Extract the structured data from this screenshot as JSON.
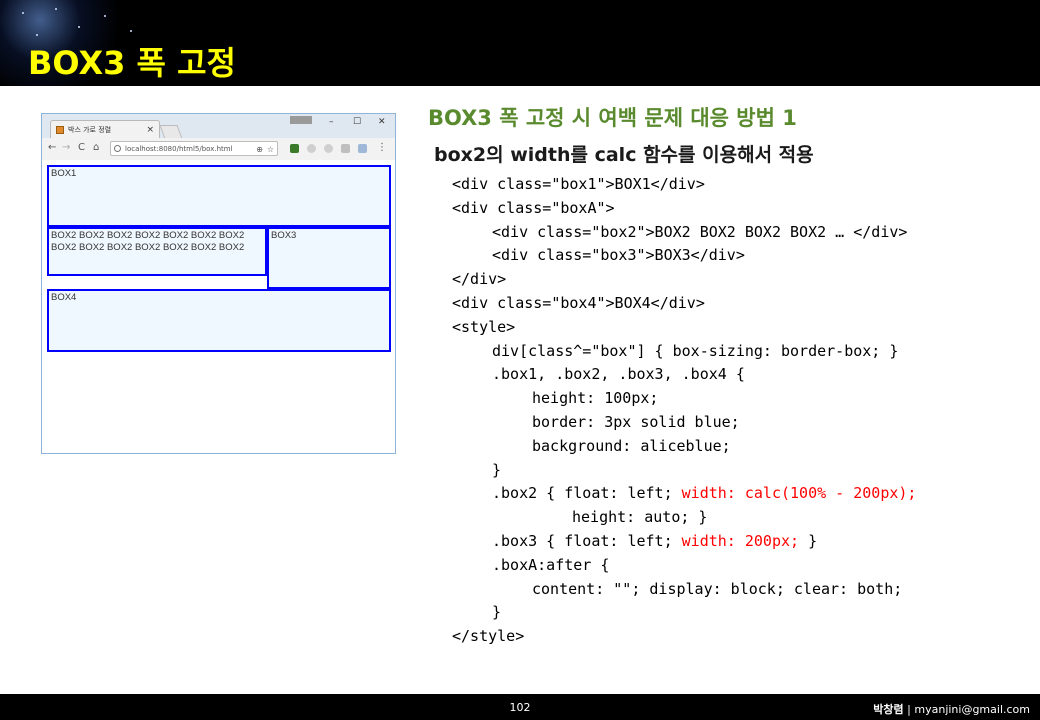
{
  "slide": {
    "title": "BOX3 폭 고정",
    "subtitle": "BOX3 폭 고정 시 여백 문제 대응 방법 1",
    "heading": "box2의 width를 calc 함수를 이용해서 적용",
    "colors": {
      "title": "#ffff00",
      "subtitle": "#5a8a2e",
      "highlight": "#ff0000",
      "demo_border": "#0000ff",
      "demo_background": "#f0f8ff"
    }
  },
  "browser": {
    "tab_label": "박스 가로 정렬",
    "tab_close": "×",
    "window_controls": [
      "–",
      "☐",
      "✕"
    ],
    "nav_buttons": [
      "←",
      "→",
      "C",
      "⌂"
    ],
    "url": "localhost:8080/html5/box.html",
    "menu": "⋮",
    "boxes": {
      "box1": "BOX1",
      "box2": "BOX2 BOX2 BOX2 BOX2 BOX2 BOX2 BOX2 BOX2 BOX2 BOX2 BOX2 BOX2 BOX2 BOX2",
      "box3": "BOX3",
      "box4": "BOX4"
    }
  },
  "code": {
    "lines": [
      {
        "indent": 0,
        "parts": [
          {
            "t": "<div class=\"box1\">BOX1</div>"
          }
        ]
      },
      {
        "indent": 0,
        "parts": [
          {
            "t": "<div class=\"boxA\">"
          }
        ]
      },
      {
        "indent": 1,
        "parts": [
          {
            "t": "<div class=\"box2\">BOX2 BOX2 BOX2 BOX2 … </div>"
          }
        ]
      },
      {
        "indent": 1,
        "parts": [
          {
            "t": "<div class=\"box3\">BOX3</div>"
          }
        ]
      },
      {
        "indent": 0,
        "parts": [
          {
            "t": "</div>"
          }
        ]
      },
      {
        "indent": 0,
        "parts": [
          {
            "t": "<div class=\"box4\">BOX4</div>"
          }
        ]
      },
      {
        "indent": 0,
        "parts": [
          {
            "t": "<style>"
          }
        ]
      },
      {
        "indent": 1,
        "parts": [
          {
            "t": "div[class^=\"box\"] { box-sizing: border-box; }"
          }
        ]
      },
      {
        "indent": 1,
        "parts": [
          {
            "t": ".box1, .box2, .box3, .box4 {"
          }
        ]
      },
      {
        "indent": 2,
        "parts": [
          {
            "t": "height: 100px;"
          }
        ]
      },
      {
        "indent": 2,
        "parts": [
          {
            "t": "border: 3px solid blue;"
          }
        ]
      },
      {
        "indent": 2,
        "parts": [
          {
            "t": "background: aliceblue;"
          }
        ]
      },
      {
        "indent": 1,
        "parts": [
          {
            "t": "}"
          }
        ]
      },
      {
        "indent": 1,
        "parts": [
          {
            "t": ".box2 { float: left; "
          },
          {
            "t": "width: calc(100% - 200px);",
            "red": true
          }
        ]
      },
      {
        "indent": 3,
        "parts": [
          {
            "t": "height: auto; }"
          }
        ]
      },
      {
        "indent": 1,
        "parts": [
          {
            "t": ".box3 { float: left; "
          },
          {
            "t": "width: 200px;",
            "red": true
          },
          {
            "t": " }"
          }
        ]
      },
      {
        "indent": 1,
        "parts": [
          {
            "t": ".boxA:after {"
          }
        ]
      },
      {
        "indent": 2,
        "parts": [
          {
            "t": "content: \"\"; display: block; clear: both;"
          }
        ]
      },
      {
        "indent": 1,
        "parts": [
          {
            "t": "}"
          }
        ]
      },
      {
        "indent": 0,
        "parts": [
          {
            "t": "</style>"
          }
        ]
      }
    ]
  },
  "footer": {
    "page": "102",
    "author": "박창렴",
    "separator": " | ",
    "email": "myanjini@gmail.com"
  }
}
